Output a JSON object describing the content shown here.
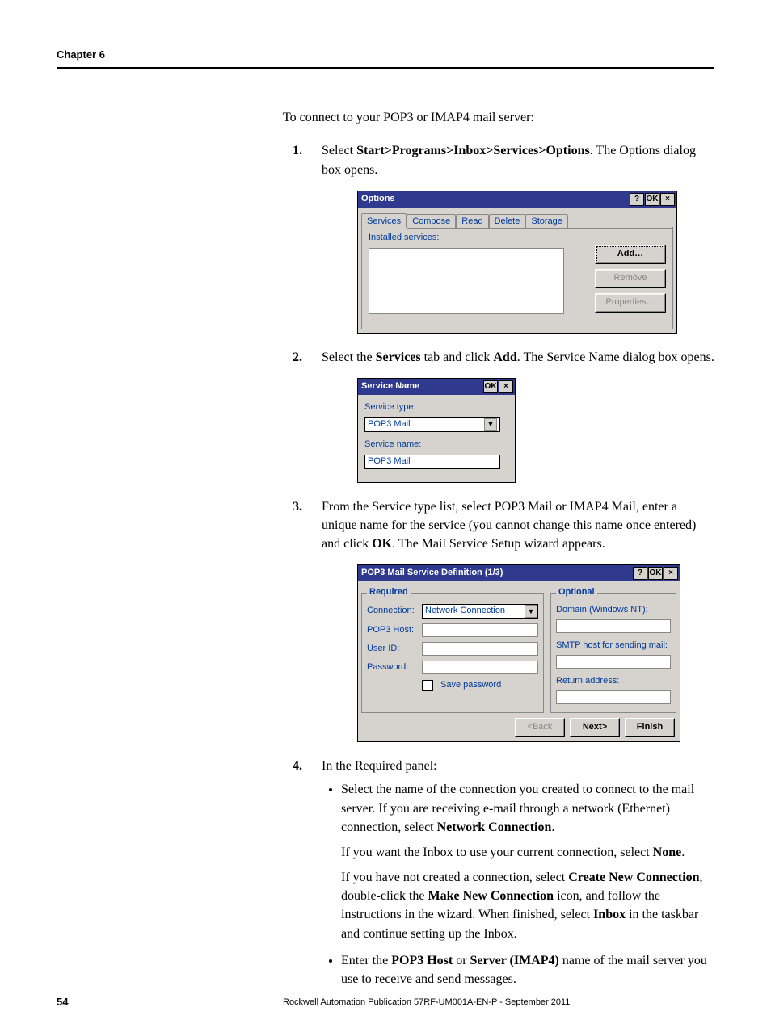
{
  "header": {
    "chapter": "Chapter 6"
  },
  "intro": "To connect to your POP3 or IMAP4 mail server:",
  "steps": {
    "s1_a": "Select ",
    "s1_b": "Start>Programs>Inbox>Services>Options",
    "s1_c": ". The Options dialog box opens.",
    "s2_a": "Select the ",
    "s2_b": "Services",
    "s2_c": " tab and click ",
    "s2_d": "Add",
    "s2_e": ". The Service Name dialog box opens.",
    "s3_a": "From the Service type list, select POP3 Mail or IMAP4 Mail, enter a unique name for the service (you cannot change this name once entered) and click ",
    "s3_b": "OK",
    "s3_c": ". The Mail Service Setup wizard appears.",
    "s4": "In the Required panel:",
    "s4b1a": "Select the name of the connection you created to connect to the mail server. If you are receiving e-mail through a network (Ethernet) connection, select ",
    "s4b1b": "Network Connection",
    "s4b1c": ".",
    "s4b1p2a": "If you want the Inbox to use your current connection, select ",
    "s4b1p2b": "None",
    "s4b1p2c": ".",
    "s4b1p3a": "If you have not created a connection, select ",
    "s4b1p3b": "Create New Connection",
    "s4b1p3c": ", double-click the ",
    "s4b1p3d": "Make New Connection",
    "s4b1p3e": " icon, and follow the instructions in the wizard. When finished, select ",
    "s4b1p3f": "Inbox",
    "s4b1p3g": " in the taskbar and continue setting up the Inbox.",
    "s4b2a": "Enter the ",
    "s4b2b": "POP3 Host",
    "s4b2c": " or ",
    "s4b2d": "Server (IMAP4)",
    "s4b2e": " name of the mail server you use to receive and send messages.",
    "n1": "1.",
    "n2": "2.",
    "n3": "3.",
    "n4": "4."
  },
  "options_dialog": {
    "title": "Options",
    "help": "?",
    "ok": "OK",
    "close": "×",
    "tabs": [
      "Services",
      "Compose",
      "Read",
      "Delete",
      "Storage"
    ],
    "installed_label": "Installed services:",
    "add": "Add…",
    "remove": "Remove",
    "properties": "Properties…"
  },
  "service_name_dialog": {
    "title": "Service Name",
    "ok": "OK",
    "close": "×",
    "type_label": "Service type:",
    "type_value": "POP3 Mail",
    "name_label": "Service name:",
    "name_value": "POP3 Mail"
  },
  "wizard_dialog": {
    "title": "POP3 Mail Service Definition (1/3)",
    "help": "?",
    "ok": "OK",
    "close": "×",
    "required_legend": "Required",
    "optional_legend": "Optional",
    "connection_label": "Connection:",
    "connection_value": "Network Connection",
    "pop3host_label": "POP3 Host:",
    "userid_label": "User ID:",
    "password_label": "Password:",
    "save_pw": "Save password",
    "domain_label": "Domain (Windows NT):",
    "smtp_label": "SMTP host for sending mail:",
    "return_label": "Return address:",
    "back": "<Back",
    "next": "Next>",
    "finish": "Finish"
  },
  "footer": {
    "page": "54",
    "pub": "Rockwell Automation Publication 57RF-UM001A-EN-P - September 2011"
  }
}
